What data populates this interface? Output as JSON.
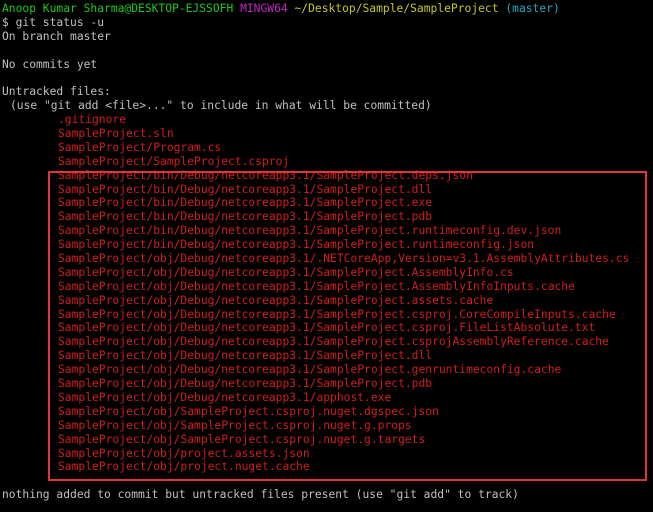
{
  "prompt": {
    "user_host": "Anoop Kumar Sharma@DESKTOP-EJSSOFH",
    "shell": "MINGW64",
    "cwd": "~/Desktop/Sample/SampleProject",
    "branch": "(master)"
  },
  "command": "$ git status -u",
  "output": {
    "on_branch": "On branch master",
    "no_commits": "No commits yet",
    "untracked_header": "Untracked files:",
    "hint": "(use \"git add <file>...\" to include in what will be committed)",
    "files_top": [
      ".gitignore",
      "SampleProject.sln",
      "SampleProject/Program.cs",
      "SampleProject/SampleProject.csproj"
    ],
    "files_highlighted": [
      "SampleProject/bin/Debug/netcoreapp3.1/SampleProject.deps.json",
      "SampleProject/bin/Debug/netcoreapp3.1/SampleProject.dll",
      "SampleProject/bin/Debug/netcoreapp3.1/SampleProject.exe",
      "SampleProject/bin/Debug/netcoreapp3.1/SampleProject.pdb",
      "SampleProject/bin/Debug/netcoreapp3.1/SampleProject.runtimeconfig.dev.json",
      "SampleProject/bin/Debug/netcoreapp3.1/SampleProject.runtimeconfig.json",
      "SampleProject/obj/Debug/netcoreapp3.1/.NETCoreApp,Version=v3.1.AssemblyAttributes.cs",
      "SampleProject/obj/Debug/netcoreapp3.1/SampleProject.AssemblyInfo.cs",
      "SampleProject/obj/Debug/netcoreapp3.1/SampleProject.AssemblyInfoInputs.cache",
      "SampleProject/obj/Debug/netcoreapp3.1/SampleProject.assets.cache",
      "SampleProject/obj/Debug/netcoreapp3.1/SampleProject.csproj.CoreCompileInputs.cache",
      "SampleProject/obj/Debug/netcoreapp3.1/SampleProject.csproj.FileListAbsolute.txt",
      "SampleProject/obj/Debug/netcoreapp3.1/SampleProject.csprojAssemblyReference.cache",
      "SampleProject/obj/Debug/netcoreapp3.1/SampleProject.dll",
      "SampleProject/obj/Debug/netcoreapp3.1/SampleProject.genruntimeconfig.cache",
      "SampleProject/obj/Debug/netcoreapp3.1/SampleProject.pdb",
      "SampleProject/obj/Debug/netcoreapp3.1/apphost.exe",
      "SampleProject/obj/SampleProject.csproj.nuget.dgspec.json",
      "SampleProject/obj/SampleProject.csproj.nuget.g.props",
      "SampleProject/obj/SampleProject.csproj.nuget.g.targets",
      "SampleProject/obj/project.assets.json",
      "SampleProject/obj/project.nuget.cache"
    ],
    "footer": "nothing added to commit but untracked files present (use \"git add\" to track)"
  },
  "colors": {
    "background": "#000000",
    "text": "#c0c0c0",
    "user_host": "#19c919",
    "shell": "#c026c0",
    "cwd": "#c6c61d",
    "branch": "#1fa9c4",
    "untracked": "#d21d1d",
    "highlight_border": "#e0353d"
  }
}
